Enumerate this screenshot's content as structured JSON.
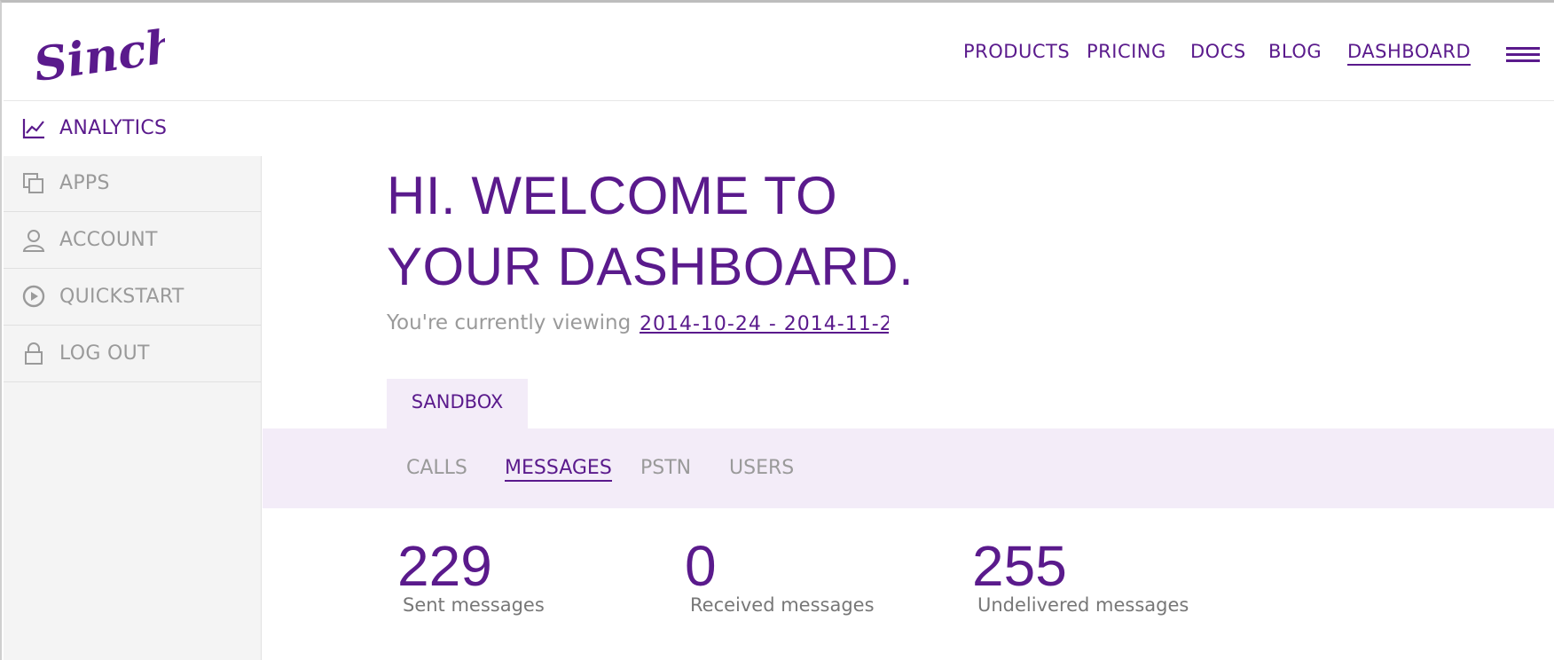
{
  "brand": {
    "logo_text": "Sinch!",
    "color": "#5a1a8c"
  },
  "topnav": {
    "items": [
      {
        "label": "PRODUCTS"
      },
      {
        "label": "PRICING"
      },
      {
        "label": "DOCS"
      },
      {
        "label": "BLOG"
      },
      {
        "label": "DASHBOARD",
        "active": true
      }
    ],
    "menu_icon": "hamburger-icon"
  },
  "sidebar": {
    "items": [
      {
        "label": "ANALYTICS",
        "icon": "line-chart-icon",
        "active": true
      },
      {
        "label": "APPS",
        "icon": "copy-icon"
      },
      {
        "label": "ACCOUNT",
        "icon": "user-icon"
      },
      {
        "label": "QUICKSTART",
        "icon": "play-circle-icon"
      },
      {
        "label": "LOG OUT",
        "icon": "lock-icon"
      }
    ]
  },
  "main": {
    "welcome_line1": "HI. WELCOME TO",
    "welcome_line2": "YOUR DASHBOARD.",
    "viewing_text": "You're currently viewing",
    "date_range": "2014-10-24 - 2014-11-2",
    "environment_tab": "SANDBOX",
    "tabs": [
      {
        "label": "CALLS"
      },
      {
        "label": "MESSAGES",
        "active": true
      },
      {
        "label": "PSTN"
      },
      {
        "label": "USERS"
      }
    ],
    "stats": [
      {
        "value": "229",
        "caption": "Sent messages"
      },
      {
        "value": "0",
        "caption": "Received messages"
      },
      {
        "value": "255",
        "caption": "Undelivered messages"
      }
    ]
  },
  "colors": {
    "accent": "#5a1a8c",
    "muted_text": "#9a9a9a",
    "tab_bar_bg": "#f3ecf8",
    "sidebar_bg": "#f4f4f4"
  }
}
